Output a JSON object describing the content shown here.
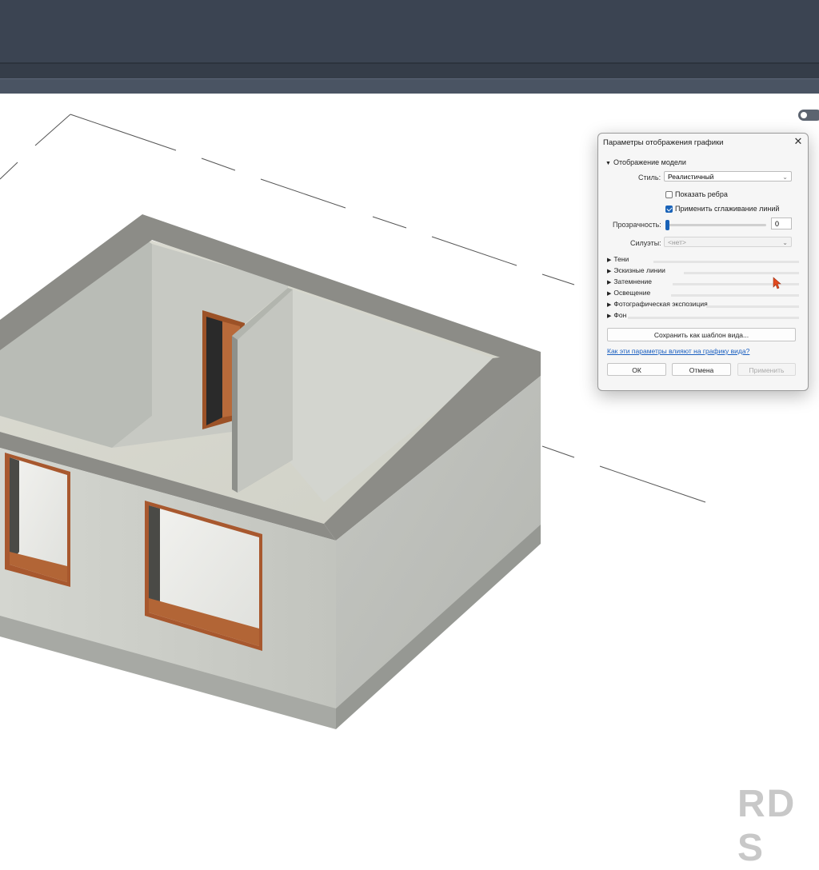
{
  "dialog": {
    "title": "Параметры отображения графики",
    "close_glyph": "✕",
    "model_section": "Отображение модели",
    "style_label": "Стиль:",
    "style_value": "Реалистичный",
    "show_edges_label": "Показать ребра",
    "show_edges_checked": false,
    "antialias_label": "Применить сглаживание линий",
    "antialias_checked": true,
    "transparency_label": "Прозрачность:",
    "transparency_value": "0",
    "silhouettes_label": "Силуэты:",
    "silhouettes_value": "<нет>",
    "sections": [
      "Тени",
      "Эскизные линии",
      "Затемнение",
      "Освещение",
      "Фотографическая экспозиция",
      "Фон"
    ],
    "save_template_button": "Сохранить как шаблон вида...",
    "help_link": "Как эти параметры влияют на графику вида?",
    "ok_button": "ОК",
    "cancel_button": "Отмена",
    "apply_button": "Применить"
  },
  "watermark": "RD S",
  "colors": {
    "accent": "#1a63b8",
    "toolbar": "#3b4452",
    "wall": "#c6c8c2",
    "wall_top": "#8b8b86",
    "trim": "#a8582e"
  },
  "icons": [
    "close-icon",
    "expand-triangle-icon",
    "collapse-triangle-icon",
    "dropdown-caret-icon",
    "checkbox-icon",
    "mouse-cursor-icon",
    "toggle-icon"
  ]
}
